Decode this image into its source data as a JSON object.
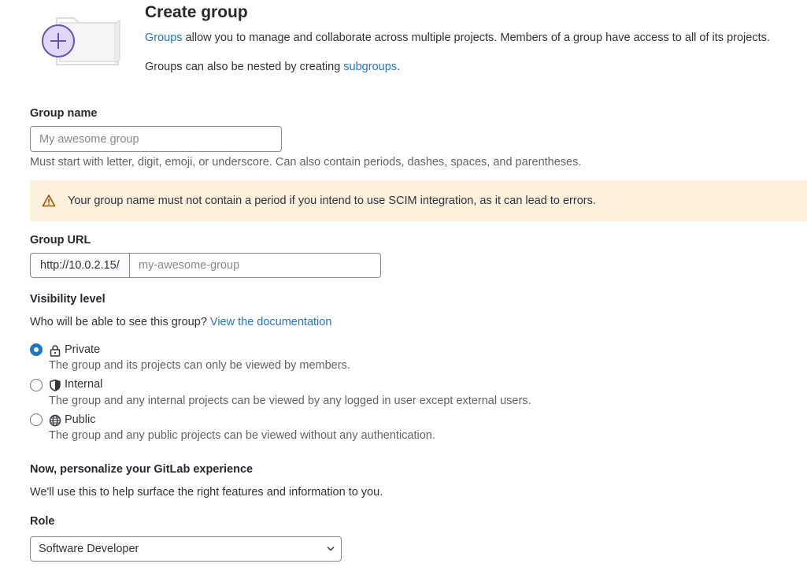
{
  "header": {
    "title": "Create group",
    "intro_link": "Groups",
    "intro_rest": " allow you to manage and collaborate across multiple projects. Members of a group have access to all of its projects.",
    "nested_prefix": "Groups can also be nested by creating ",
    "nested_link": "subgroups",
    "nested_suffix": "."
  },
  "group_name": {
    "label": "Group name",
    "placeholder": "My awesome group",
    "value": "",
    "help": "Must start with letter, digit, emoji, or underscore. Can also contain periods, dashes, spaces, and parentheses."
  },
  "alert": {
    "icon": "warning-icon",
    "text": "Your group name must not contain a period if you intend to use SCIM integration, as it can lead to errors."
  },
  "group_url": {
    "label": "Group URL",
    "prefix": "http://10.0.2.15/",
    "placeholder": "my-awesome-group",
    "value": ""
  },
  "visibility": {
    "label": "Visibility level",
    "question": "Who will be able to see this group? ",
    "doc_link": "View the documentation",
    "options": [
      {
        "label": "Private",
        "icon": "lock-icon",
        "checked": true,
        "description": "The group and its projects can only be viewed by members."
      },
      {
        "label": "Internal",
        "icon": "shield-icon",
        "checked": false,
        "description": "The group and any internal projects can be viewed by any logged in user except external users."
      },
      {
        "label": "Public",
        "icon": "globe-icon",
        "checked": false,
        "description": "The group and any public projects can be viewed without any authentication."
      }
    ]
  },
  "personalize": {
    "heading": "Now, personalize your GitLab experience",
    "text": "We'll use this to help surface the right features and information to you."
  },
  "role": {
    "label": "Role",
    "selected": "Software Developer"
  },
  "colors": {
    "link": "#1f75cb",
    "alert_bg": "#fdf1dd",
    "accent_purple": "#6b4fbb"
  }
}
